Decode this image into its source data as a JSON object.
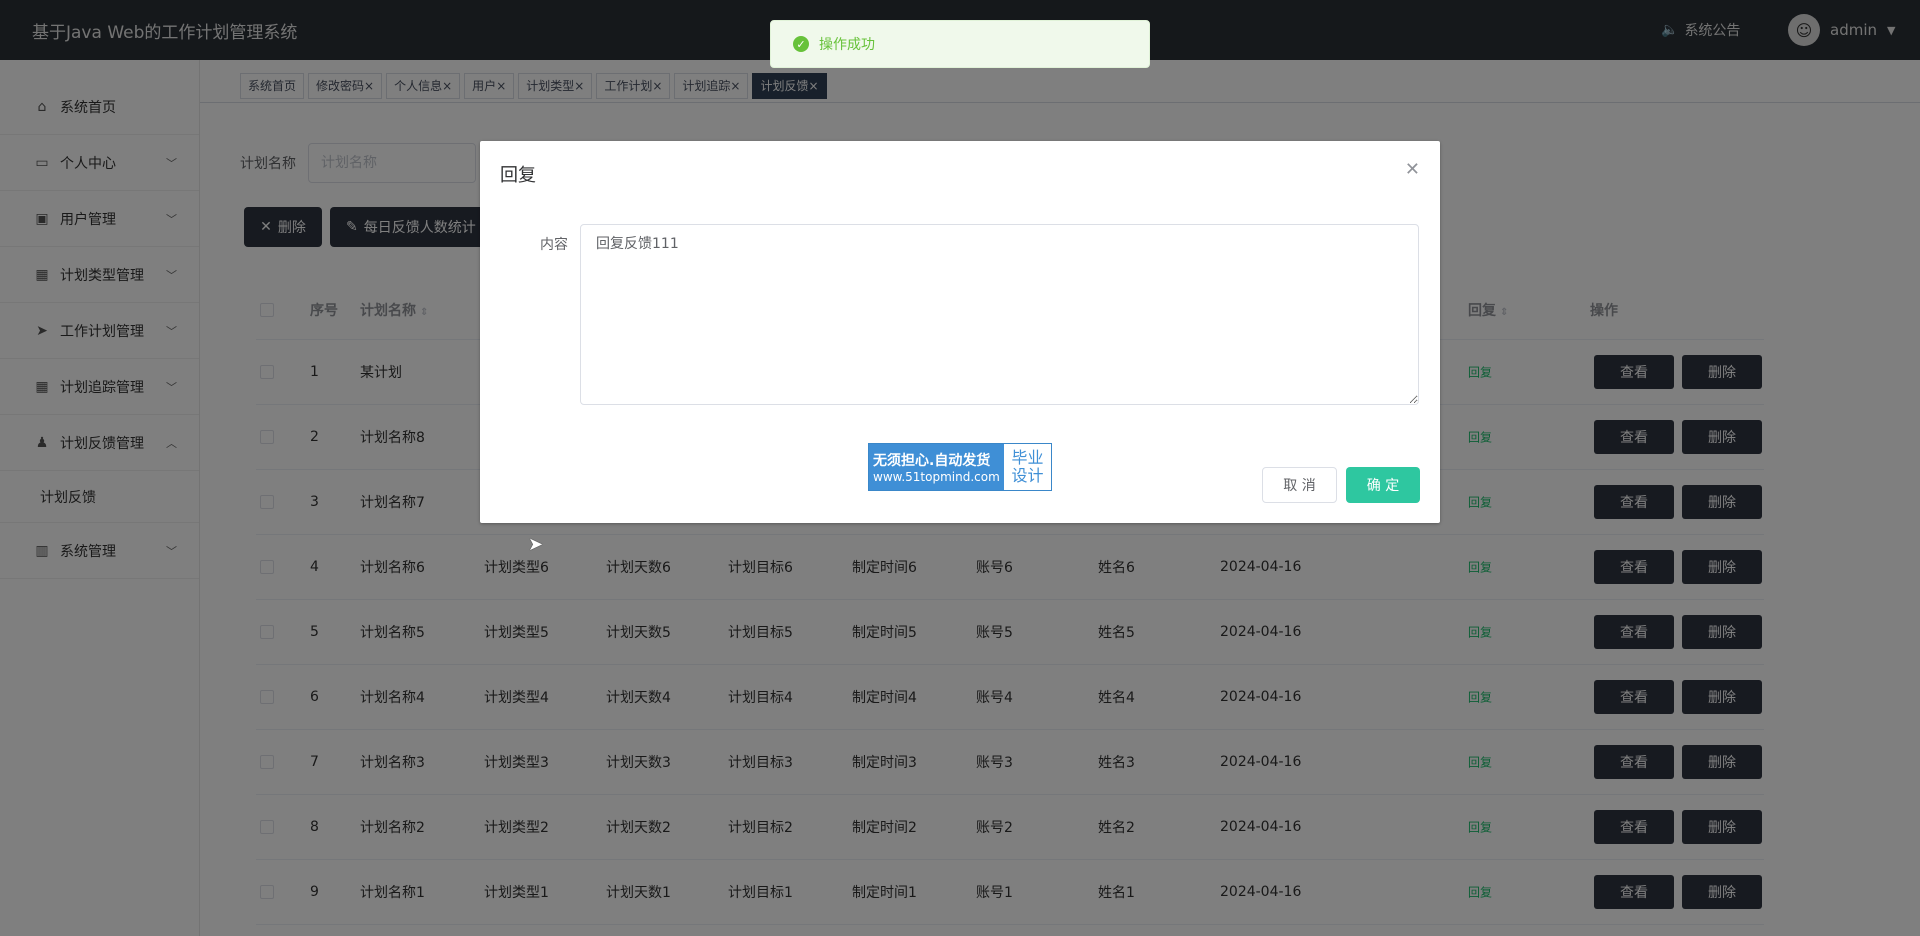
{
  "header": {
    "title": "基于Java Web的工作计划管理系统",
    "notice": "系统公告",
    "username": "admin"
  },
  "sidebar": {
    "items": [
      {
        "label": "系统首页",
        "icon": "home-icon",
        "arrow": false
      },
      {
        "label": "个人中心",
        "icon": "card-icon",
        "arrow": true
      },
      {
        "label": "用户管理",
        "icon": "briefcase-icon",
        "arrow": true
      },
      {
        "label": "计划类型管理",
        "icon": "grid-icon",
        "arrow": true
      },
      {
        "label": "工作计划管理",
        "icon": "send-icon",
        "arrow": true
      },
      {
        "label": "计划追踪管理",
        "icon": "grid-icon",
        "arrow": true
      },
      {
        "label": "计划反馈管理",
        "icon": "user-icon",
        "arrow": true,
        "expanded": true
      },
      {
        "label": "系统管理",
        "icon": "chart-icon",
        "arrow": true
      }
    ],
    "subitem": "计划反馈"
  },
  "tags": [
    {
      "label": "系统首页",
      "closable": false
    },
    {
      "label": "修改密码",
      "closable": true
    },
    {
      "label": "个人信息",
      "closable": true
    },
    {
      "label": "用户",
      "closable": true
    },
    {
      "label": "计划类型",
      "closable": true
    },
    {
      "label": "工作计划",
      "closable": true
    },
    {
      "label": "计划追踪",
      "closable": true
    },
    {
      "label": "计划反馈",
      "closable": true,
      "active": true
    }
  ],
  "search": {
    "label": "计划名称",
    "placeholder": "计划名称"
  },
  "actions": {
    "delete": "删除",
    "stats": "每日反馈人数统计"
  },
  "table": {
    "columns": [
      "序号",
      "计划名称",
      "回复",
      "操作"
    ],
    "rows": [
      {
        "no": "1",
        "name": "某计划",
        "type": "",
        "days": "",
        "goal": "",
        "time": "",
        "account": "",
        "person": "",
        "date": ""
      },
      {
        "no": "2",
        "name": "计划名称8",
        "type": "",
        "days": "",
        "goal": "",
        "time": "",
        "account": "",
        "person": "",
        "date": ""
      },
      {
        "no": "3",
        "name": "计划名称7",
        "type": "",
        "days": "",
        "goal": "",
        "time": "",
        "account": "",
        "person": "",
        "date": ""
      },
      {
        "no": "4",
        "name": "计划名称6",
        "type": "计划类型6",
        "days": "计划天数6",
        "goal": "计划目标6",
        "time": "制定时间6",
        "account": "账号6",
        "person": "姓名6",
        "date": "2024-04-16"
      },
      {
        "no": "5",
        "name": "计划名称5",
        "type": "计划类型5",
        "days": "计划天数5",
        "goal": "计划目标5",
        "time": "制定时间5",
        "account": "账号5",
        "person": "姓名5",
        "date": "2024-04-16"
      },
      {
        "no": "6",
        "name": "计划名称4",
        "type": "计划类型4",
        "days": "计划天数4",
        "goal": "计划目标4",
        "time": "制定时间4",
        "account": "账号4",
        "person": "姓名4",
        "date": "2024-04-16"
      },
      {
        "no": "7",
        "name": "计划名称3",
        "type": "计划类型3",
        "days": "计划天数3",
        "goal": "计划目标3",
        "time": "制定时间3",
        "account": "账号3",
        "person": "姓名3",
        "date": "2024-04-16"
      },
      {
        "no": "8",
        "name": "计划名称2",
        "type": "计划类型2",
        "days": "计划天数2",
        "goal": "计划目标2",
        "time": "制定时间2",
        "account": "账号2",
        "person": "姓名2",
        "date": "2024-04-16"
      },
      {
        "no": "9",
        "name": "计划名称1",
        "type": "计划类型1",
        "days": "计划天数1",
        "goal": "计划目标1",
        "time": "制定时间1",
        "account": "账号1",
        "person": "姓名1",
        "date": "2024-04-16"
      }
    ],
    "reply_link": "回复",
    "view_label": "查看",
    "delete_label": "删除"
  },
  "toast": {
    "message": "操作成功"
  },
  "dialog": {
    "title": "回复",
    "field_label": "内容",
    "content": "回复反馈111",
    "cancel": "取 消",
    "confirm": "确 定"
  },
  "watermark": {
    "line1": "无须担心.自动发货",
    "line2": "www.51topmind.com",
    "right1": "毕业",
    "right2": "设计"
  },
  "colors": {
    "header_bg": "#2b3137",
    "primary": "#2ec7a0",
    "success": "#67c23a",
    "dark_button": "#2e3440"
  }
}
